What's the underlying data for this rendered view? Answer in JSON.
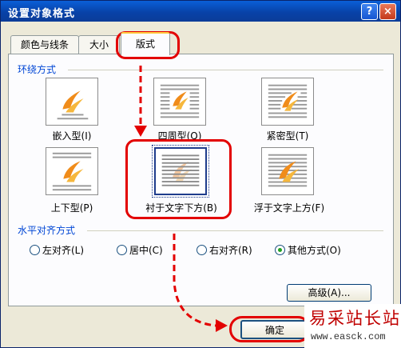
{
  "dialog": {
    "title": "设置对象格式",
    "help_glyph": "?",
    "close_glyph": "×"
  },
  "tabs": [
    {
      "label": "颜色与线条"
    },
    {
      "label": "大小"
    },
    {
      "label": "版式",
      "active": true
    }
  ],
  "wrap_section": {
    "title": "环绕方式",
    "options": [
      {
        "label": "嵌入型(I)",
        "icon": "inline-wrap-icon"
      },
      {
        "label": "四周型(Q)",
        "icon": "square-wrap-icon"
      },
      {
        "label": "紧密型(T)",
        "icon": "tight-wrap-icon"
      },
      {
        "label": "上下型(P)",
        "icon": "top-bottom-wrap-icon"
      },
      {
        "label": "衬于文字下方(B)",
        "icon": "behind-text-icon",
        "selected": true
      },
      {
        "label": "浮于文字上方(F)",
        "icon": "in-front-of-text-icon"
      }
    ]
  },
  "align_section": {
    "title": "水平对齐方式",
    "options": [
      {
        "label": "左对齐(L)",
        "checked": false
      },
      {
        "label": "居中(C)",
        "checked": false
      },
      {
        "label": "右对齐(R)",
        "checked": false
      },
      {
        "label": "其他方式(O)",
        "checked": true
      }
    ]
  },
  "buttons": {
    "advanced": "高级(A)...",
    "ok": "确定"
  },
  "watermark": {
    "text": "易采站长站",
    "url": "www.easck.com"
  },
  "colors": {
    "titlebar": "#0842a8",
    "annotation": "#e30000",
    "dialog_bg": "#ece9d8",
    "group_title": "#0046d5"
  }
}
